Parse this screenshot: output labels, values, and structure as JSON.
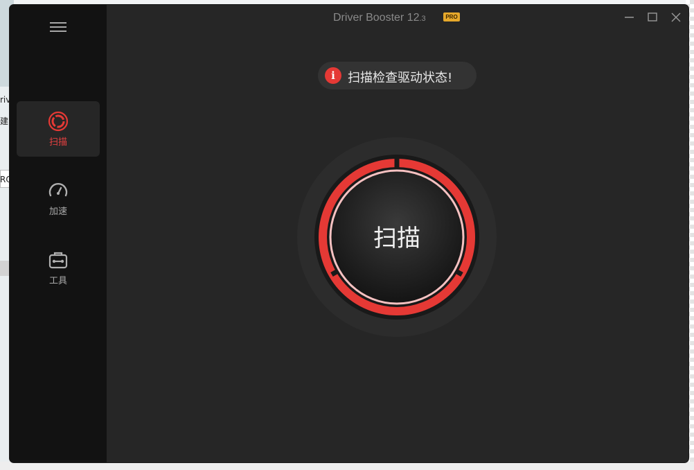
{
  "background": {
    "left_text_1": "riv",
    "left_text_2": "建",
    "left_text_3": "RO"
  },
  "app": {
    "title": "Driver Booster 12",
    "version": ".3",
    "badge": "PRO",
    "accent_color": "#e53935"
  },
  "sidebar": {
    "menu_icon": "hamburger-menu-icon",
    "items": [
      {
        "label": "扫描",
        "icon": "scan-icon",
        "active": true
      },
      {
        "label": "加速",
        "icon": "speedometer-icon",
        "active": false
      },
      {
        "label": "工具",
        "icon": "toolbox-icon",
        "active": false
      }
    ]
  },
  "window_controls": [
    "minimize-icon",
    "maximize-icon",
    "close-icon"
  ],
  "status": {
    "icon": "info-icon",
    "icon_char": "i",
    "text": "扫描检查驱动状态!"
  },
  "scan": {
    "label": "扫描"
  },
  "hardware_panel": {
    "icons": [
      "monitor-icon",
      "windows-icon",
      "cpu-icon",
      "network-card-icon",
      "memory-icon",
      "more-icon"
    ]
  }
}
